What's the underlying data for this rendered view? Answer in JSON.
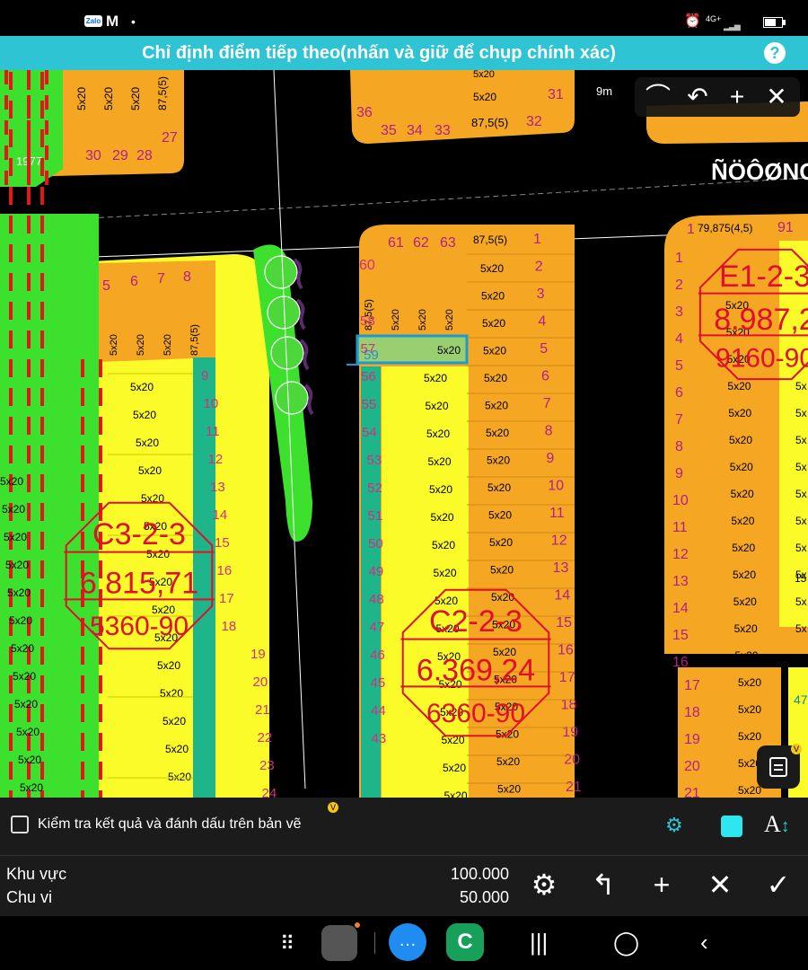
{
  "status_bar": {
    "apps": [
      "Zalo",
      "Gmail"
    ],
    "network": "4G+"
  },
  "banner": {
    "text": "Chỉ định điểm tiếp theo(nhấn và giữ để chụp chính xác)",
    "help_label": "?"
  },
  "draw_toolbar": {
    "icons": [
      "arc-icon",
      "undo-icon",
      "plus-icon",
      "close-icon"
    ]
  },
  "map": {
    "scale_label": "9m",
    "street_label": "ÑÖÔØNG",
    "corner_label": "1977",
    "stamps": [
      {
        "code": "C3-2-3",
        "area": "6.815,71",
        "ref": "5360-90"
      },
      {
        "code": "C2-2-3",
        "area": "6.369,24",
        "ref": "6360-90"
      },
      {
        "code": "E1-2-3",
        "area": "8.987,2",
        "ref": "9160-90"
      }
    ],
    "lot_size": "5x20",
    "corner_lot_size": "87,5(5)",
    "e1_corner_size": "79,875(4,5)",
    "selected_lot": {
      "number": "59",
      "size": "5x20"
    },
    "top_lots_left": [
      "30",
      "29",
      "28",
      "27"
    ],
    "top_lots_mid": [
      "36",
      "35",
      "34",
      "33",
      "32",
      "31"
    ],
    "c1_lots_top": [
      "5",
      "6",
      "7",
      "8"
    ],
    "c2_top": [
      "61",
      "62",
      "63"
    ],
    "c2_left_nums": [
      "60",
      "59",
      "58",
      "57",
      "56",
      "55",
      "54",
      "53",
      "52",
      "51",
      "50",
      "49",
      "48",
      "47",
      "46",
      "45",
      "44",
      "43"
    ],
    "c2_right_nums": [
      "1",
      "2",
      "3",
      "4",
      "5",
      "6",
      "7",
      "8",
      "9",
      "10",
      "11",
      "12",
      "13",
      "14",
      "15",
      "16",
      "17",
      "18",
      "19",
      "20",
      "21"
    ],
    "c1_right_nums": [
      "9",
      "10",
      "11",
      "12",
      "13",
      "14",
      "15",
      "16",
      "17",
      "18",
      "19",
      "20",
      "21",
      "22",
      "23",
      "24"
    ],
    "e1_left_nums": [
      "1",
      "2",
      "3",
      "4",
      "5",
      "6",
      "7",
      "8",
      "9",
      "10",
      "11",
      "12",
      "13",
      "14",
      "15",
      "16"
    ],
    "e1_right_top": "91",
    "e2_nums": [
      "17",
      "18",
      "19",
      "20",
      "21"
    ],
    "e2_right_num": "47",
    "e1_right_edge": [
      "15"
    ]
  },
  "check_row": {
    "label": "Kiểm tra kết quả và đánh dấu trên bản vẽ",
    "badge": "V",
    "swatch_color": "#2ee6f0"
  },
  "measure": {
    "area_label": "Khu vực",
    "area_value": "100.000",
    "perimeter_label": "Chu vi",
    "perimeter_value": "50.000"
  },
  "colors": {
    "orange": "#f5a623",
    "yellow": "#fbfb2a",
    "green": "#3de02c",
    "teal": "#1fb58a",
    "road": "#000000",
    "stamp": "#e0102a",
    "accent": "#2ec4d4"
  }
}
